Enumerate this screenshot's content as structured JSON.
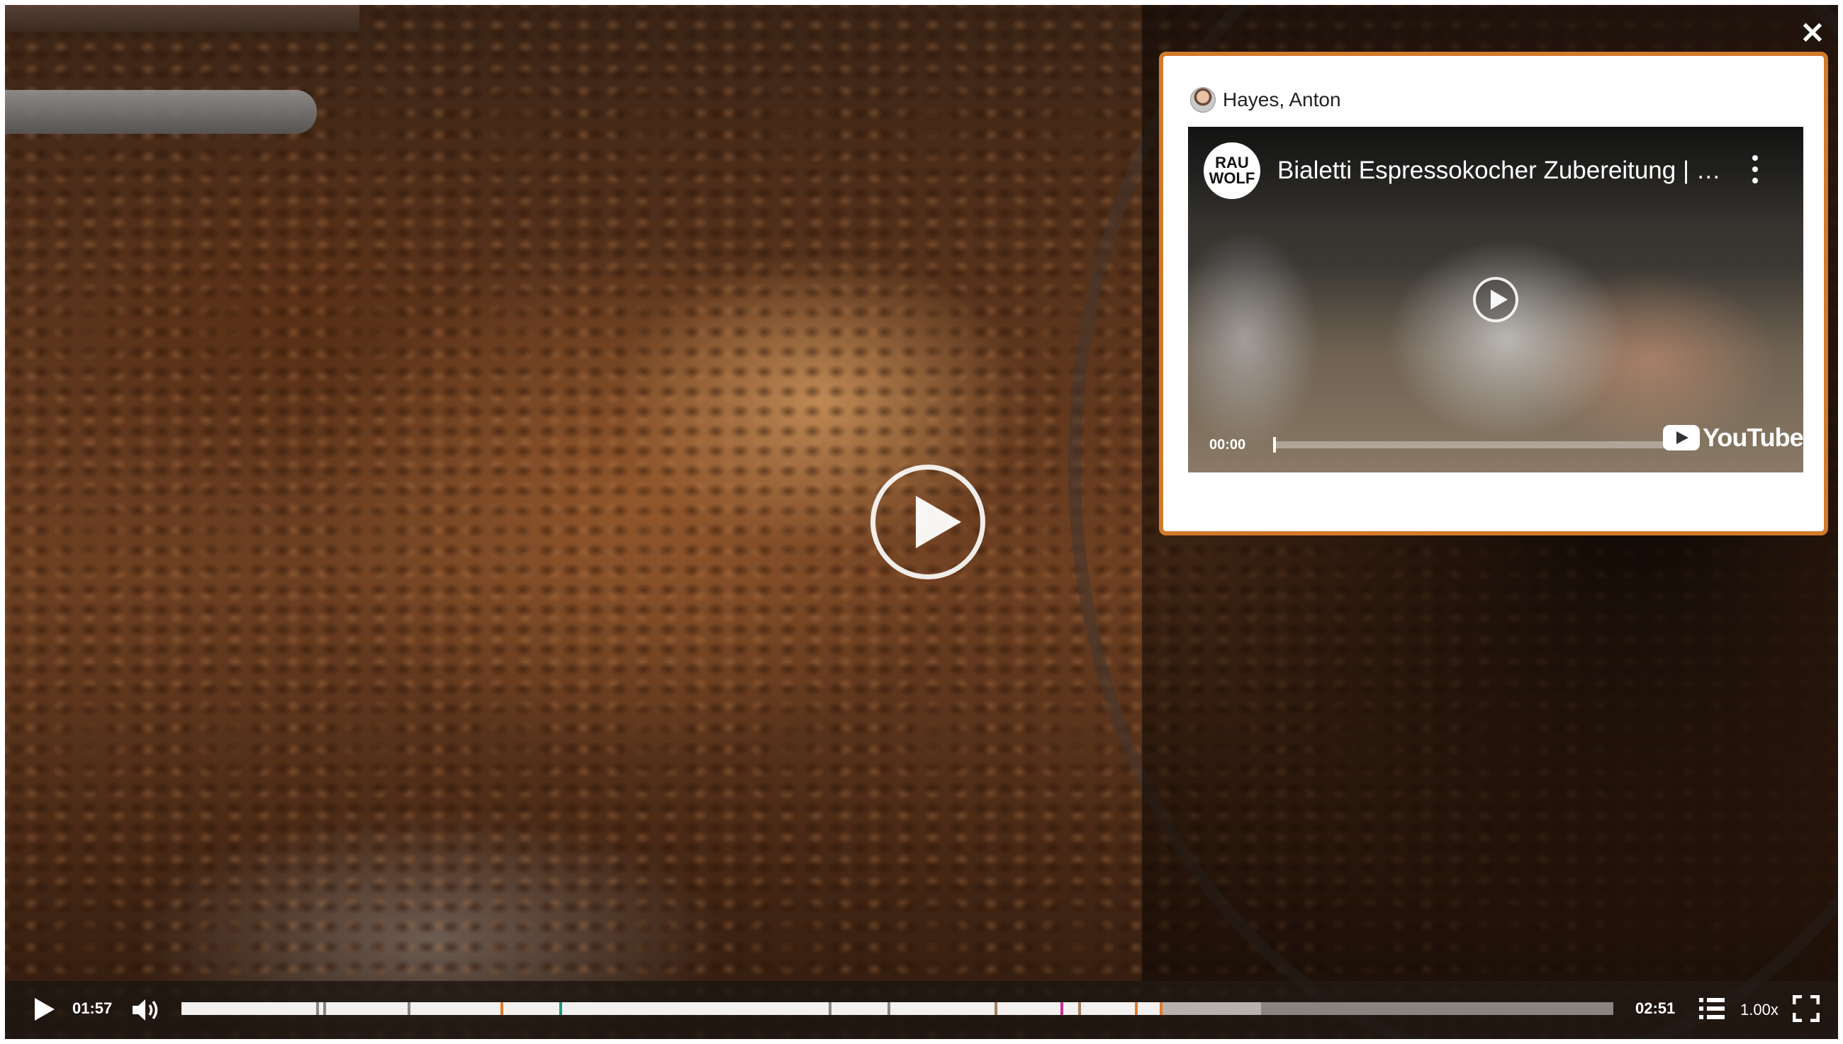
{
  "popup": {
    "author": "Hayes, Anton",
    "video": {
      "channel_logo_line1": "RAU",
      "channel_logo_line2": "WOLF",
      "title": "Bialetti Espressokocher Zubereitung | Rauwolf",
      "time": "00:00",
      "logo_text": "YouTube"
    }
  },
  "player": {
    "current_time": "01:57",
    "duration": "02:51",
    "speed": "1.00x",
    "progress_fraction": 0.684,
    "buffered_fraction": 0.754,
    "markers": [
      {
        "pos": 0.094,
        "color": "#8a8480"
      },
      {
        "pos": 0.099,
        "color": "#8a8480"
      },
      {
        "pos": 0.158,
        "color": "#8a8480"
      },
      {
        "pos": 0.223,
        "color": "#e07b27"
      },
      {
        "pos": 0.264,
        "color": "#1a9a7a"
      },
      {
        "pos": 0.452,
        "color": "#8a8480"
      },
      {
        "pos": 0.493,
        "color": "#8a8480"
      },
      {
        "pos": 0.568,
        "color": "#a0815e"
      },
      {
        "pos": 0.614,
        "color": "#d02aa0"
      },
      {
        "pos": 0.626,
        "color": "#a0815e"
      },
      {
        "pos": 0.666,
        "color": "#e07b27"
      },
      {
        "pos": 0.683,
        "color": "#e07b27"
      },
      {
        "pos": 0.819,
        "color": "#8a8480"
      }
    ]
  },
  "icons": {
    "close": "close-icon",
    "center_play": "play-circle-icon",
    "play": "play-icon",
    "volume": "volume-icon",
    "chapters": "list-icon",
    "fullscreen": "fullscreen-icon",
    "yt_menu": "more-vertical-icon"
  },
  "colors": {
    "card_border": "#d17a2a",
    "timeline_played": "#f3f1ef",
    "timeline_track": "#8a8480"
  }
}
